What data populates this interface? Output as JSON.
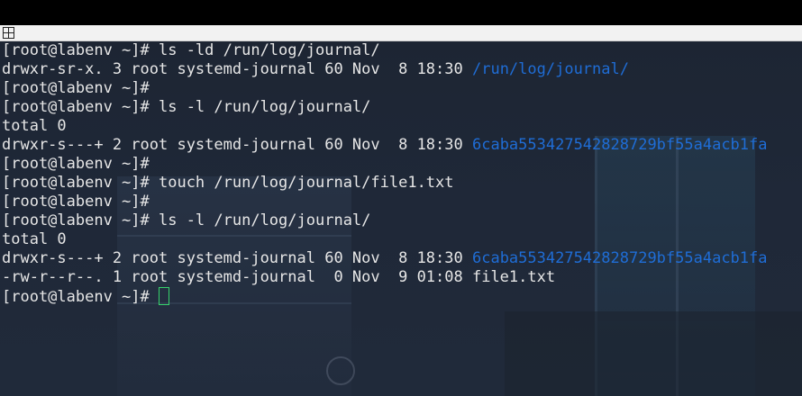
{
  "terminal": {
    "lines": [
      {
        "text": "[root@labenv ~]# ls -ld /run/log/journal/",
        "highlight": ""
      },
      {
        "text": "drwxr-sr-x. 3 root systemd-journal 60 Nov  8 18:30 ",
        "highlight": "/run/log/journal/"
      },
      {
        "text": "[root@labenv ~]#",
        "highlight": ""
      },
      {
        "text": "[root@labenv ~]# ls -l /run/log/journal/",
        "highlight": ""
      },
      {
        "text": "total 0",
        "highlight": ""
      },
      {
        "text": "drwxr-s---+ 2 root systemd-journal 60 Nov  8 18:30 ",
        "highlight": "6caba553427542828729bf55a4acb1fa"
      },
      {
        "text": "[root@labenv ~]#",
        "highlight": ""
      },
      {
        "text": "[root@labenv ~]# touch /run/log/journal/file1.txt",
        "highlight": ""
      },
      {
        "text": "[root@labenv ~]#",
        "highlight": ""
      },
      {
        "text": "[root@labenv ~]# ls -l /run/log/journal/",
        "highlight": ""
      },
      {
        "text": "total 0",
        "highlight": ""
      },
      {
        "text": "drwxr-s---+ 2 root systemd-journal 60 Nov  8 18:30 ",
        "highlight": "6caba553427542828729bf55a4acb1fa"
      },
      {
        "text": "-rw-r--r--. 1 root systemd-journal  0 Nov  9 01:08 file1.txt",
        "highlight": ""
      }
    ],
    "prompt": "[root@labenv ~]# ",
    "colors": {
      "text": "#e6e6e6",
      "directory": "#1f6dd6",
      "cursor": "#36d36b",
      "background": "#1f2838"
    }
  },
  "tab": {
    "icon": "grid-icon"
  }
}
